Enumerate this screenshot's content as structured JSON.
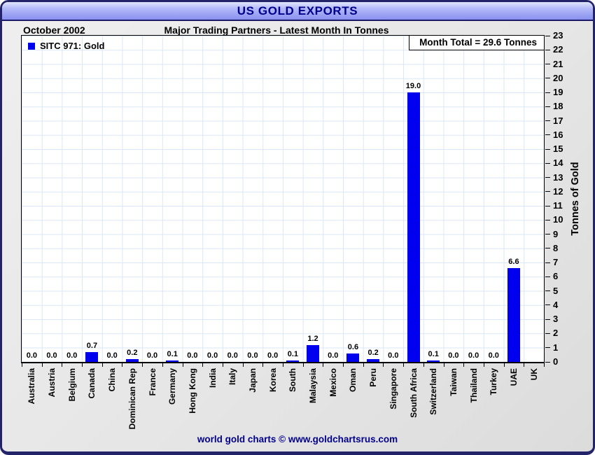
{
  "frame": {
    "title": "US GOLD EXPORTS",
    "footer": "world gold charts © www.goldchartsrus.com"
  },
  "header": {
    "date": "October 2002",
    "subtitle": "Major Trading Partners - Latest Month In Tonnes"
  },
  "plot": {
    "legend_label": "SITC 971: Gold",
    "month_total": "Month Total = 29.6 Tonnes"
  },
  "colors": {
    "bar": "#0000EE",
    "accent_navy": "#00008B",
    "grid": "#DBE7F6"
  },
  "chart_data": {
    "type": "bar",
    "title": "US GOLD EXPORTS",
    "subtitle": "Major Trading Partners - Latest Month In Tonnes",
    "period": "October 2002",
    "series_name": "SITC 971: Gold",
    "month_total_label": "Month Total = 29.6 Tonnes",
    "month_total_tonnes": 29.6,
    "ylabel": "Tonnes of Gold",
    "ylim": [
      0,
      23
    ],
    "ytick_step": 1,
    "grid": true,
    "legend_position": "top-left",
    "bar_color": "#0000EE",
    "categories": [
      "Australia",
      "Austria",
      "Belgium",
      "Canada",
      "China",
      "Dominican Rep",
      "France",
      "Germany",
      "Hong Kong",
      "India",
      "Italy",
      "Japan",
      "Korea",
      "South",
      "Malaysia",
      "Mexico",
      "Oman",
      "Peru",
      "Singapore",
      "South Africa",
      "Switzerland",
      "Taiwan",
      "Thailand",
      "Turkey",
      "UAE",
      "UK"
    ],
    "values": [
      0.0,
      0.0,
      0.0,
      0.7,
      0.0,
      0.2,
      0.0,
      0.1,
      0.0,
      0.0,
      0.0,
      0.0,
      0.0,
      0.1,
      1.2,
      0.0,
      0.6,
      0.2,
      0.0,
      19.0,
      0.1,
      0.0,
      0.0,
      0.0,
      6.6,
      null
    ],
    "value_labels": [
      "0.0",
      "0.0",
      "0.0",
      "0.7",
      "0.0",
      "0.2",
      "0.0",
      "0.1",
      "0.0",
      "0.0",
      "0.0",
      "0.0",
      "0.0",
      "0.1",
      "1.2",
      "0.0",
      "0.6",
      "0.2",
      "0.0",
      "19.0",
      "0.1",
      "0.0",
      "0.0",
      "0.0",
      "6.6",
      ""
    ]
  }
}
